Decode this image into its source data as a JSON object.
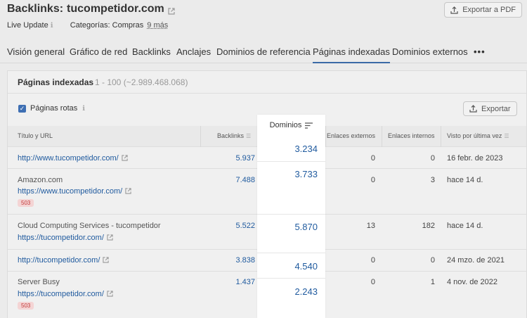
{
  "header": {
    "title_prefix": "Backlinks:",
    "domain": "tucompetidor.com",
    "export_pdf_label": "Exportar a PDF"
  },
  "meta": {
    "live_update": "Live Update",
    "categories": "Categorías: Compras",
    "more": "9 más"
  },
  "tabs": [
    {
      "label": "Visión general"
    },
    {
      "label": "Gráfico de red"
    },
    {
      "label": "Backlinks"
    },
    {
      "label": "Anclajes"
    },
    {
      "label": "Dominios de referencia"
    },
    {
      "label": "Páginas indexadas",
      "active": true
    },
    {
      "label": "Dominios externos"
    }
  ],
  "tab_more": "•••",
  "card": {
    "title": "Páginas indexadas",
    "range": "1 - 100 (~2.989.468.068)",
    "checkbox_label": "Páginas rotas",
    "checkbox_checked": true,
    "export_label": "Exportar"
  },
  "table": {
    "columns": {
      "title_url": "Título y URL",
      "backlinks": "Backlinks",
      "dominios": "Dominios",
      "enlaces_externos": "Enlaces externos",
      "enlaces_internos": "Enlaces internos",
      "visto": "Visto por última vez"
    },
    "rows": [
      {
        "title": "",
        "url": "http://www.tucompetidor.com/",
        "badge": "",
        "backlinks": "5.937",
        "dominios": "3.234",
        "externos": "0",
        "internos": "0",
        "visto": "16 febr. de 2023"
      },
      {
        "title": "Amazon.com",
        "url": "https://www.tucompetidor.com/",
        "badge": "503",
        "backlinks": "7.488",
        "dominios": "3.733",
        "externos": "0",
        "internos": "3",
        "visto": "hace 14 d."
      },
      {
        "title": "Cloud Computing Services - tucompetidor",
        "url": "https://tucompetidor.com/",
        "badge": "",
        "backlinks": "5.522",
        "dominios": "5.870",
        "externos": "13",
        "internos": "182",
        "visto": "hace 14 d."
      },
      {
        "title": "",
        "url": "http://tucompetidor.com/",
        "badge": "",
        "backlinks": "3.838",
        "dominios": "4.540",
        "externos": "0",
        "internos": "0",
        "visto": "24 mzo. de 2021"
      },
      {
        "title": "Server Busy",
        "url": "https://tucompetidor.com/",
        "badge": "503",
        "backlinks": "1.437",
        "dominios": "2.243",
        "externos": "0",
        "internos": "1",
        "visto": "4 nov. de 2022"
      }
    ]
  },
  "colors": {
    "link": "#1f5a9e",
    "accent": "#3b6aa6",
    "error_badge_bg": "#f4d4d4",
    "error_badge_text": "#c23b3b"
  }
}
